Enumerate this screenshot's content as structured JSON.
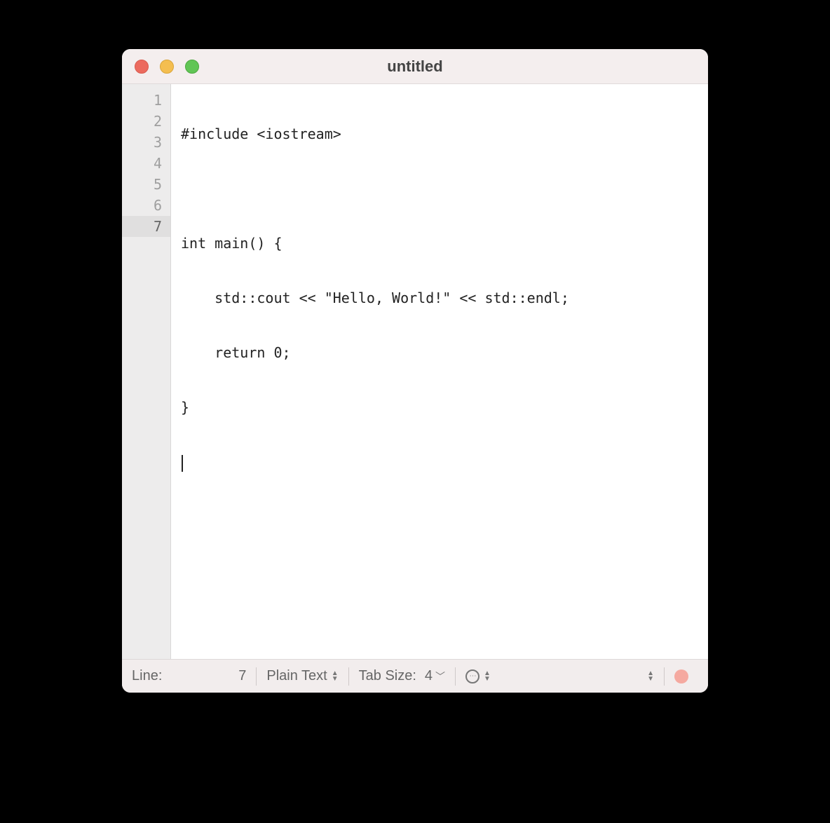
{
  "window": {
    "title": "untitled"
  },
  "editor": {
    "line_numbers": [
      "1",
      "2",
      "3",
      "4",
      "5",
      "6",
      "7"
    ],
    "current_line_index": 6,
    "lines": [
      "#include <iostream>",
      "",
      "int main() {",
      "    std::cout << \"Hello, World!\" << std::endl;",
      "    return 0;",
      "}",
      ""
    ]
  },
  "statusbar": {
    "line_label": "Line:",
    "line_value": "7",
    "syntax_label": "Plain Text",
    "tab_label": "Tab Size:",
    "tab_value": "4"
  }
}
